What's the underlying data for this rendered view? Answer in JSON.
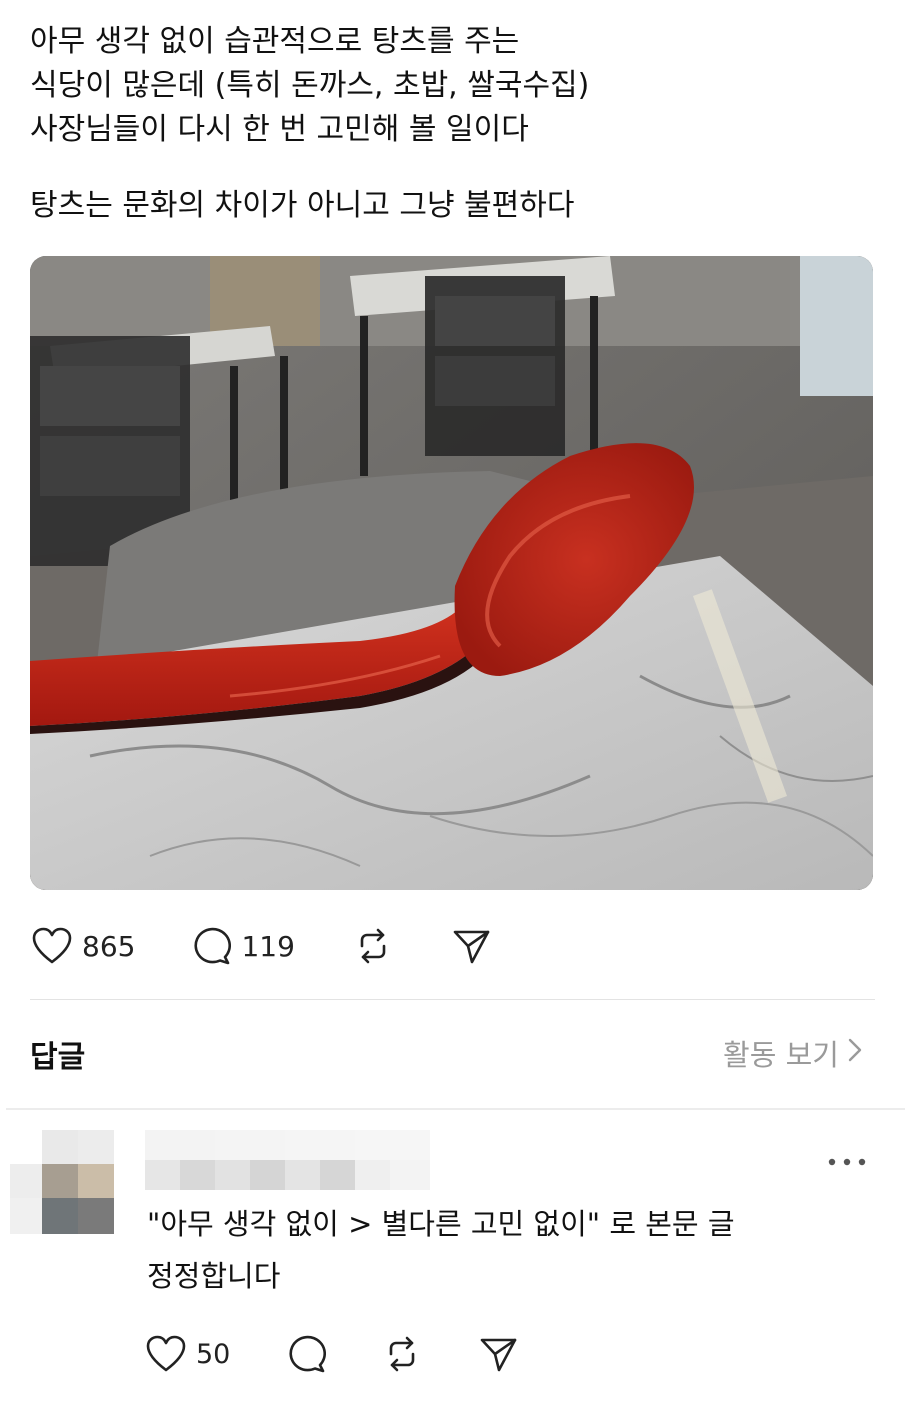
{
  "post": {
    "lines": [
      "아무 생각 없이 습관적으로 탕츠를 주는",
      "식당이 많은데 (특히 돈까스, 초밥, 쌀국수집)",
      "사장님들이 다시 한 번 고민해 볼 일이다",
      "탕츠는 문화의 차이가 아니고 그냥 불편하다"
    ],
    "actions": {
      "like_icon": "heart-icon",
      "like_count": "865",
      "comment_icon": "comment-bubble-icon",
      "comment_count": "119",
      "repost_icon": "repost-icon",
      "share_icon": "send-icon"
    }
  },
  "replies": {
    "header": "답글",
    "activity_link": "활동 보기",
    "chevron_icon": "chevron-right-icon"
  },
  "reply": {
    "more_icon": "more-dots-icon",
    "lines": [
      "\"아무 생각 없이 > 별다른 고민 없이\" 로 본문 글",
      "정정합니다"
    ],
    "actions": {
      "like_count": "50"
    }
  },
  "colors": {
    "spoon_red": "#c8281e",
    "muted_text": "#9a9a9a",
    "divider": "#e3e3e3"
  }
}
